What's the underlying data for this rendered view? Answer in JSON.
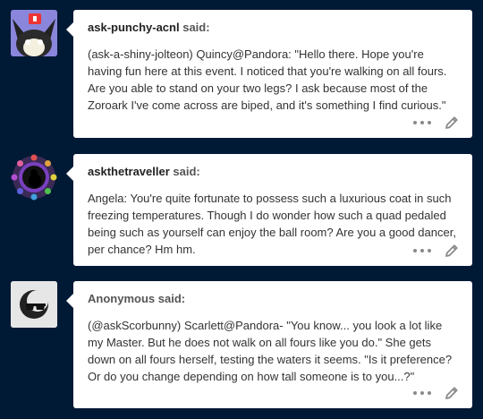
{
  "posts": [
    {
      "avatar_icon": "punchy-cat-avatar",
      "asker": "ask-punchy-acnl",
      "said": "said:",
      "question": "(ask-a-shiny-jolteon) Quincy@Pandora: \"Hello there. Hope you're having fun here at this event. I noticed that you're walking on all fours. Are you able to stand on your two legs? I ask because most of the Zoroark I've come across are biped, and it's something I find curious.\""
    },
    {
      "avatar_icon": "traveller-ring-avatar",
      "asker": "askthetraveller",
      "said": "said:",
      "question": "Angela: You're quite fortunate to possess such a luxurious coat in such freezing temperatures. Though I do wonder how such a quad pedaled being such as yourself can enjoy the ball room? Are you a good dancer, per chance? Hm hm."
    },
    {
      "avatar_icon": "anonymous-sunglasses-avatar",
      "asker": "Anonymous",
      "said": "said:",
      "question": "(@askScorbunny) Scarlett@Pandora- \"You know... you look a lot like my Master. But he does not walk on all fours like you do.\" She gets down on all fours herself, testing the waters it seems. \"Is it preference? Or do you change depending on how tall someone is to you...?\""
    }
  ],
  "icons": {
    "more": "more-options-icon",
    "edit": "edit-pencil-icon"
  },
  "colors": {
    "background": "#001935",
    "card": "#ffffff",
    "icon_gray": "#8a8a8a"
  }
}
